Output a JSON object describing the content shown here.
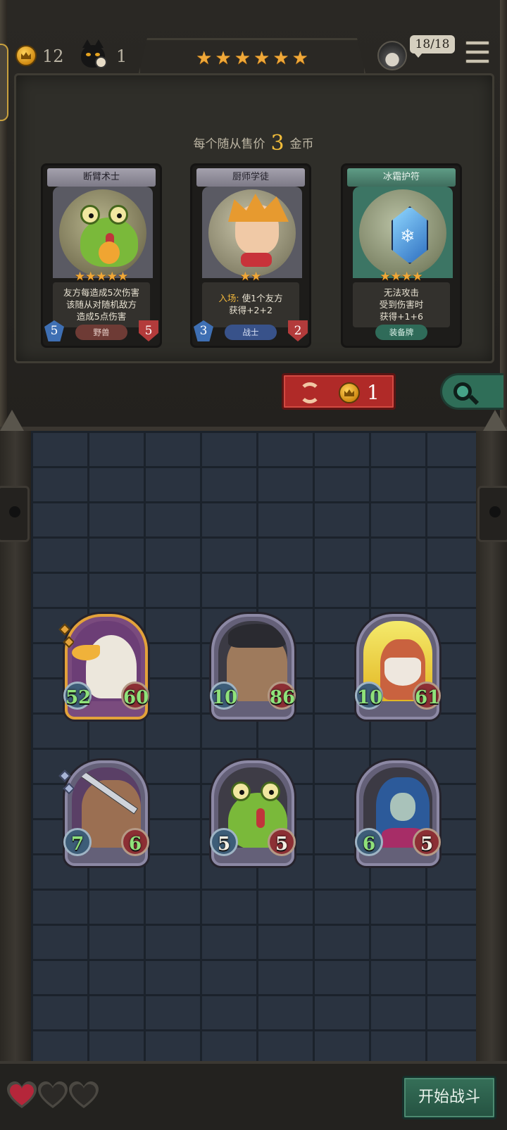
{
  "hud": {
    "gold": "12",
    "timer_tokens": "1",
    "star_rating": 6,
    "stars": [
      "★",
      "★",
      "★",
      "★",
      "★",
      "★"
    ],
    "lives_counter": "18/18",
    "icons": [
      "crown-coin-icon",
      "cat-clock-icon",
      "avatar-icon",
      "menu-icon"
    ]
  },
  "shop": {
    "price_prefix": "每个随从售价",
    "price_value": "3",
    "price_suffix": "金币",
    "cards": [
      {
        "name": "断臂术士",
        "stars": [
          "★",
          "★",
          "★",
          "★",
          "★"
        ],
        "desc_lines": [
          "友方每造成5次伤害",
          "该随从对随机敌方",
          "造成5点伤害"
        ],
        "attack": "5",
        "health": "5",
        "tribe": "野兽",
        "tribe_color": "#6e3b35"
      },
      {
        "name": "厨师学徒",
        "stars": [
          "★",
          "★"
        ],
        "keyword": "入场:",
        "desc_lines": [
          "使1个友方",
          "获得+2+2"
        ],
        "attack": "3",
        "health": "2",
        "tribe": "战士",
        "tribe_color": "#38528a"
      },
      {
        "name": "冰霜护符",
        "stars": [
          "★",
          "★",
          "★",
          "★"
        ],
        "desc_lines": [
          "无法攻击",
          "受到伤害时",
          "获得+1+6"
        ],
        "tribe": "装备牌",
        "tribe_color": "#2f6b59"
      }
    ],
    "refresh_cost": "1",
    "refresh_icon": "refresh-icon",
    "search_icon": "search-icon"
  },
  "board": {
    "minions": [
      {
        "id": "bird",
        "attack": "52",
        "health": "60",
        "buffed": true,
        "frame": "gold",
        "tier_marks": 2
      },
      {
        "id": "ogre",
        "attack": "10",
        "health": "86",
        "buffed": true,
        "frame": "silver",
        "tier_marks": 0
      },
      {
        "id": "dwarf",
        "attack": "10",
        "health": "61",
        "buffed": true,
        "frame": "silver",
        "tier_marks": 0
      },
      {
        "id": "rogue",
        "attack": "7",
        "health": "6",
        "buffed": true,
        "frame": "silver",
        "tier_marks": 2
      },
      {
        "id": "frog",
        "attack": "5",
        "health": "5",
        "buffed": false,
        "frame": "silver",
        "tier_marks": 0
      },
      {
        "id": "elf",
        "attack": "6",
        "health": "5",
        "buffed": true,
        "frame": "silver",
        "tier_marks": 0
      }
    ]
  },
  "footer": {
    "hearts_total": 3,
    "hearts_full": 1,
    "start_label": "开始战斗"
  },
  "colors": {
    "gold": "#f3bd3a",
    "buffed_stat": "#8fe27a",
    "refresh_red": "#b02a28",
    "start_green": "#356f58"
  }
}
